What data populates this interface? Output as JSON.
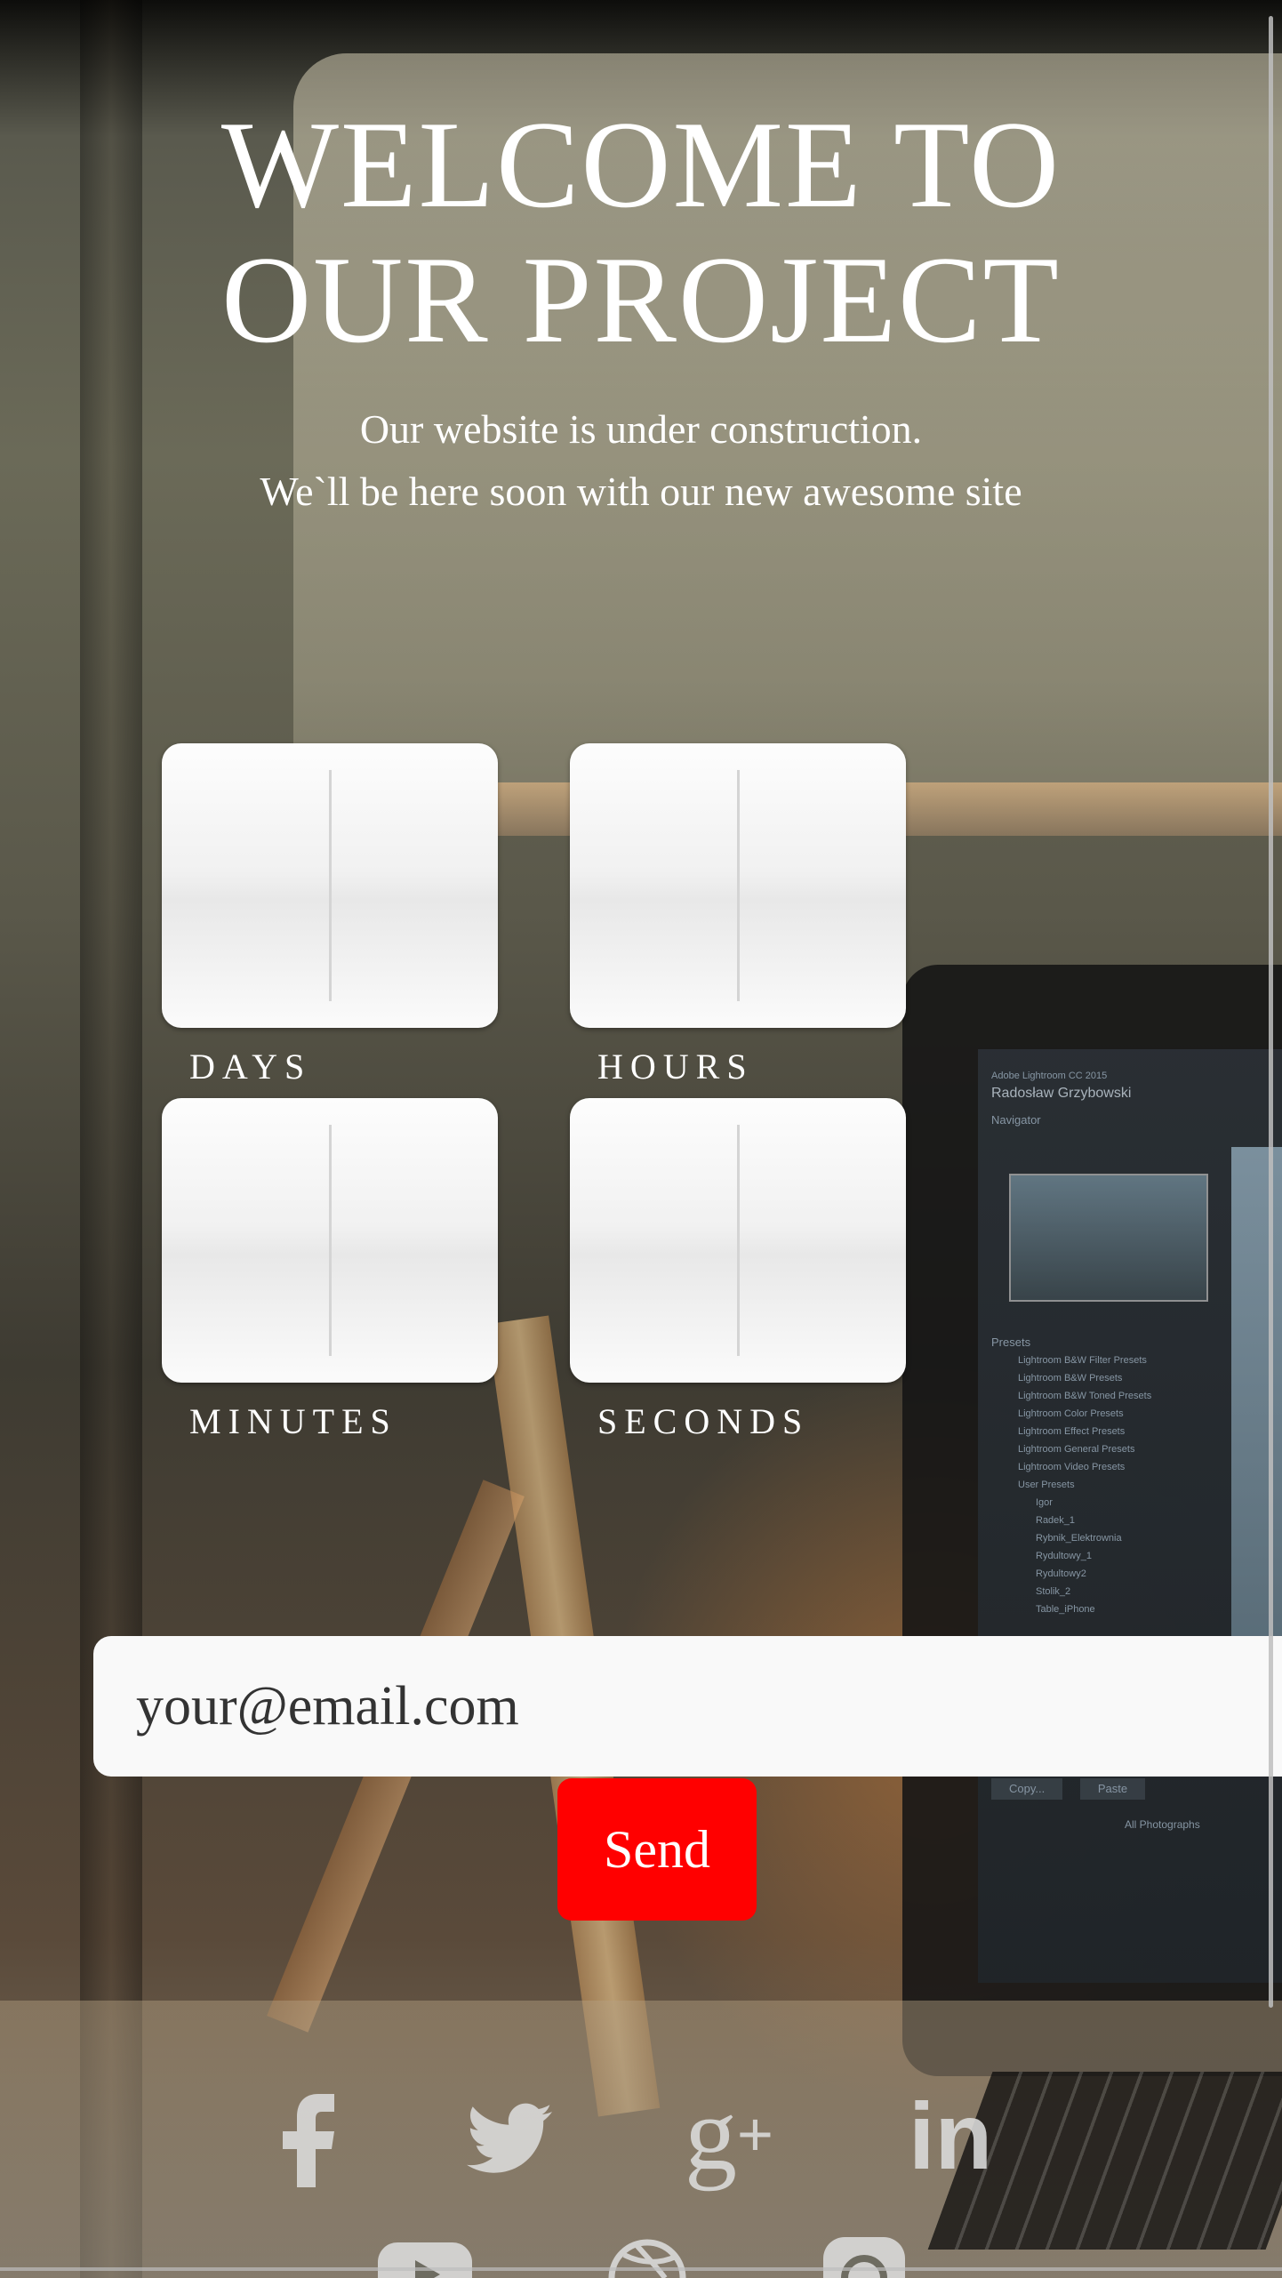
{
  "hero": {
    "title_line1": "WELCOME TO",
    "title_line2": "OUR PROJECT",
    "subtitle_line1": "Our website is under construction.",
    "subtitle_line2": "We`ll be here soon with our new awesome site"
  },
  "countdown": {
    "units": [
      {
        "label": "DAYS"
      },
      {
        "label": "HOURS"
      },
      {
        "label": "MINUTES"
      },
      {
        "label": "SECONDS"
      }
    ]
  },
  "subscribe": {
    "email_placeholder": "your@email.com",
    "send_label": "Send"
  },
  "laptop_screen": {
    "app_name": "Adobe Lightroom CC 2015",
    "user": "Radosław Grzybowski",
    "panels": [
      "Navigator",
      "Presets"
    ],
    "presets": [
      "Lightroom B&W Filter Presets",
      "Lightroom B&W Presets",
      "Lightroom B&W Toned Presets",
      "Lightroom Color Presets",
      "Lightroom Effect Presets",
      "Lightroom General Presets",
      "Lightroom Video Presets",
      "User Presets",
      "Igor",
      "Radek_1",
      "Rybnik_Elektrownia",
      "Rydultowy_1",
      "Rydultowy2",
      "Stolik_2",
      "Table_iPhone"
    ],
    "buttons": [
      "Copy...",
      "Paste"
    ],
    "filmstrip": "All Photographs"
  },
  "social": [
    {
      "name": "facebook",
      "glyph": "f"
    },
    {
      "name": "twitter",
      "glyph": "twitter-bird"
    },
    {
      "name": "google-plus",
      "glyph": "g+"
    },
    {
      "name": "linkedin",
      "glyph": "in"
    },
    {
      "name": "youtube",
      "glyph": "play"
    },
    {
      "name": "dribbble",
      "glyph": "ball"
    },
    {
      "name": "instagram",
      "glyph": "camera"
    }
  ],
  "colors": {
    "accent": "#ff0000",
    "text": "#ffffff"
  }
}
